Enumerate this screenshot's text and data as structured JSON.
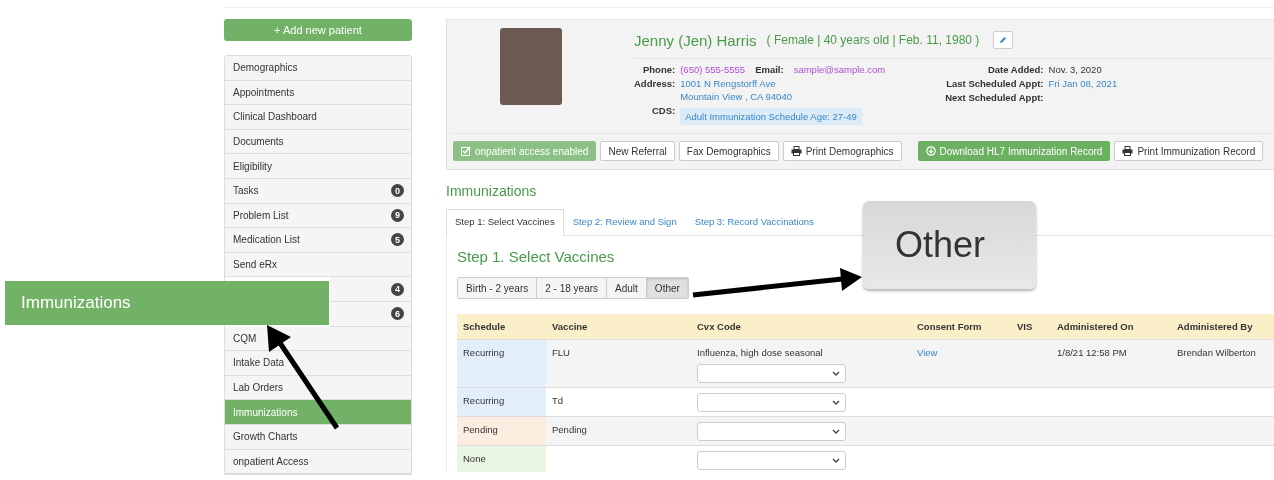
{
  "sidebar": {
    "add_button": "+ Add new patient",
    "items": [
      {
        "label": "Demographics",
        "selected": false
      },
      {
        "label": "Appointments",
        "selected": false
      },
      {
        "label": "Clinical Dashboard",
        "selected": false
      },
      {
        "label": "Documents",
        "selected": false
      },
      {
        "label": "Eligibility",
        "selected": false
      },
      {
        "label": "Tasks",
        "badge": "0",
        "selected": false
      },
      {
        "label": "Problem List",
        "badge": "9",
        "selected": false
      },
      {
        "label": "Medication List",
        "badge": "5",
        "selected": false
      },
      {
        "label": "Send eRx",
        "selected": false
      },
      {
        "badge": "4",
        "selected": false
      },
      {
        "badge": "6",
        "selected": false
      },
      {
        "label": "CQM",
        "selected": false
      },
      {
        "label": "Intake Data",
        "selected": false
      },
      {
        "label": "Lab Orders",
        "selected": false
      },
      {
        "label": "Immunizations",
        "selected": true
      },
      {
        "label": "Growth Charts",
        "selected": false
      },
      {
        "label": "onpatient Access",
        "selected": false
      }
    ]
  },
  "patient": {
    "name": "Jenny (Jen) Harris",
    "details": "( Female | 40 years old | Feb. 11, 1980 )",
    "phone_label": "Phone:",
    "phone": "(650) 555-5555",
    "email_label": "Email:",
    "email": "sample@sample.com",
    "address_label": "Address:",
    "address_lines": [
      "1001 N Rengstorff Ave",
      "Mountain View , CA 94040"
    ],
    "cds_label": "CDS:",
    "cds": "Adult Immunization Schedule Age: 27-49",
    "right_fields": [
      {
        "label": "Date Added:",
        "value": "Nov. 3, 2020",
        "kind": "text"
      },
      {
        "label": "Last Scheduled Appt:",
        "value": "Fri Jan 08, 2021",
        "kind": "link"
      },
      {
        "label": "Next Scheduled Appt:"
      }
    ],
    "buttons": [
      {
        "label": "onpatient access enabled",
        "kind": "enabled"
      },
      {
        "label": "New Referral",
        "kind": "plain"
      },
      {
        "label": "Fax Demographics",
        "kind": "plain"
      },
      {
        "label": "Print Demographics",
        "kind": "print"
      },
      {
        "label": "Download HL7 Immunization Record",
        "kind": "download"
      },
      {
        "label": "Print Immunization Record",
        "kind": "print"
      }
    ]
  },
  "heading": "Immunizations",
  "tabs": [
    {
      "label": "Step 1: Select Vaccines",
      "selected": true
    },
    {
      "label": "Step 2: Review and Sign",
      "selected": false
    },
    {
      "label": "Step 3: Record Vaccinations",
      "selected": false
    }
  ],
  "step_title": "Step 1. Select Vaccines",
  "age_groups": [
    {
      "label": "Birth - 2 years",
      "selected": false
    },
    {
      "label": "2 - 18 years",
      "selected": false
    },
    {
      "label": "Adult",
      "selected": false
    },
    {
      "label": "Other",
      "selected": true
    }
  ],
  "table": {
    "columns": [
      "Schedule",
      "Vaccine",
      "Cvx Code",
      "Consent Form",
      "VIS",
      "Administered On",
      "Administered By"
    ],
    "rows": [
      {
        "schedule": "Recurring",
        "color": "#e3eefb",
        "vaccine": "FLU",
        "cvx": "Influenza, high dose seasonal",
        "consent": "View",
        "administered_on": "1/8/21 12:58 PM",
        "administered_by": "Brendan Wilberton"
      },
      {
        "schedule": "Recurring",
        "color": "#e3eefb",
        "vaccine": "Td"
      },
      {
        "schedule": "Pending",
        "color": "#fbeee1",
        "vaccine": "Pending"
      },
      {
        "schedule": "None",
        "color": "#e9f6e3"
      }
    ]
  },
  "callouts": [
    {
      "text": "Immunizations",
      "kind": "banner"
    },
    {
      "text": "Other",
      "kind": "zoom"
    }
  ]
}
